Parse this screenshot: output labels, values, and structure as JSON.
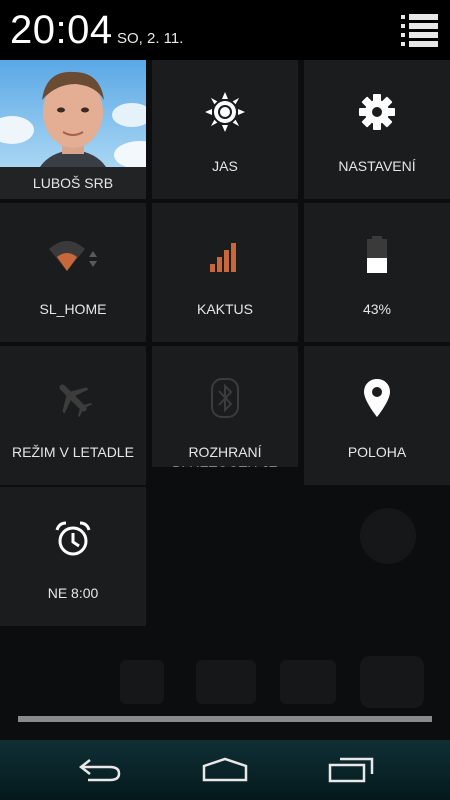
{
  "header": {
    "time": "20:04",
    "date": "SO, 2. 11."
  },
  "tiles": [
    {
      "label": "LUBOŠ SRB",
      "icon": "user-avatar"
    },
    {
      "label": "JAS",
      "icon": "brightness-icon"
    },
    {
      "label": "NASTAVENÍ",
      "icon": "gear-icon"
    },
    {
      "label": "SL_HOME",
      "icon": "wifi-icon"
    },
    {
      "label": "KAKTUS",
      "icon": "cell-signal-icon"
    },
    {
      "label": "43%",
      "icon": "battery-icon",
      "battery_level": 0.43
    },
    {
      "label": "REŽIM V LETADLE",
      "icon": "airplane-icon"
    },
    {
      "label": "ROZHRANÍ BLUETOOTH JE VYPNUTO",
      "icon": "bluetooth-icon"
    },
    {
      "label": "POLOHA",
      "icon": "location-icon"
    },
    {
      "label": "NE 8:00",
      "icon": "alarm-icon"
    }
  ],
  "colors": {
    "tile_bg": "#1b1c1d",
    "accent_signal": "#c8683a",
    "navbar": "#0f2f35"
  }
}
